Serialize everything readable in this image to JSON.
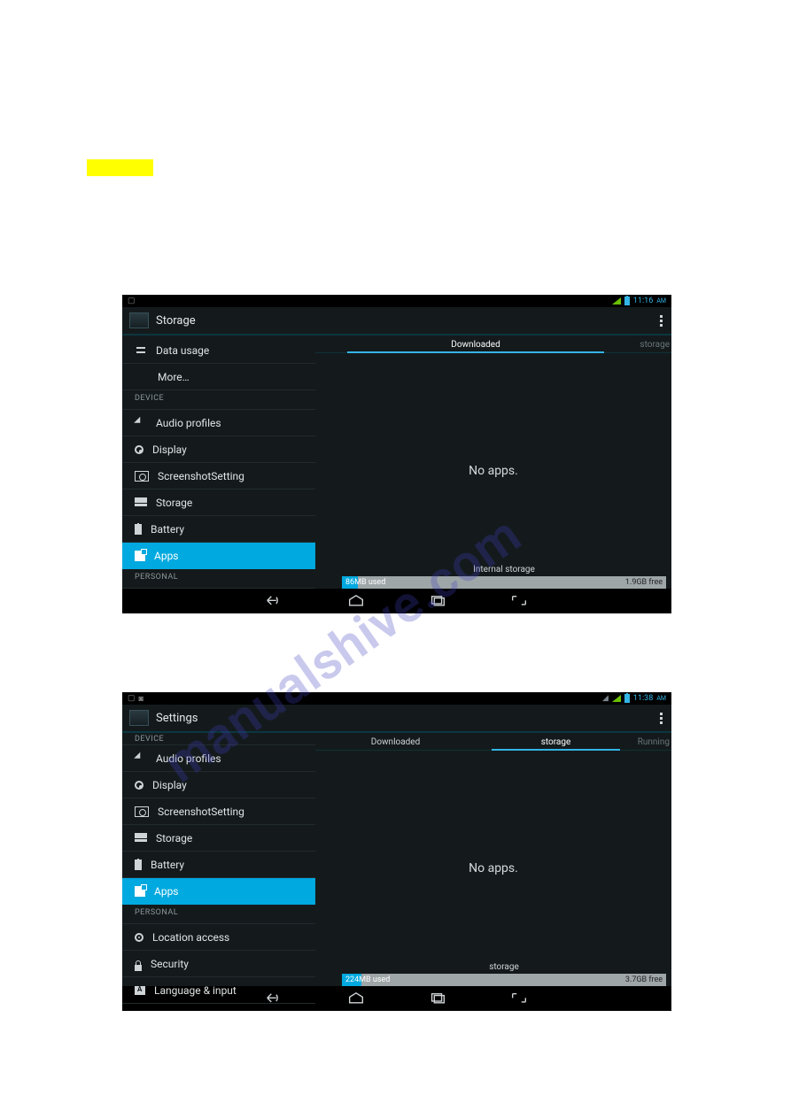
{
  "highlight_mark": true,
  "watermark_text": "manualshive.com",
  "screenshot1": {
    "status_time": "11:16",
    "status_ampm": "AM",
    "title": "Storage",
    "sidebar": {
      "items": [
        {
          "kind": "item",
          "label": "Data usage",
          "icon": "data"
        },
        {
          "kind": "item",
          "label": "More…",
          "icon": "",
          "indent": true
        },
        {
          "kind": "section",
          "label": "DEVICE"
        },
        {
          "kind": "item",
          "label": "Audio profiles",
          "icon": "audio"
        },
        {
          "kind": "item",
          "label": "Display",
          "icon": "display"
        },
        {
          "kind": "item",
          "label": "ScreenshotSetting",
          "icon": "cam"
        },
        {
          "kind": "item",
          "label": "Storage",
          "icon": "storage"
        },
        {
          "kind": "item",
          "label": "Battery",
          "icon": "batt"
        },
        {
          "kind": "item",
          "label": "Apps",
          "icon": "apps",
          "selected": true
        },
        {
          "kind": "section",
          "label": "PERSONAL"
        }
      ]
    },
    "tabs": {
      "items": [
        {
          "label": "Downloaded",
          "active": true
        },
        {
          "label": "storage",
          "cut": true
        }
      ]
    },
    "empty_text": "No apps.",
    "storage": {
      "title": "Internal storage",
      "used_text": "86MB used",
      "free_text": "1.9GB free",
      "used_pct": 5
    }
  },
  "screenshot2": {
    "status_time": "11:38",
    "status_ampm": "AM",
    "title": "Settings",
    "sidebar": {
      "header_section": "DEVICE",
      "items": [
        {
          "kind": "item",
          "label": "Audio profiles",
          "icon": "audio"
        },
        {
          "kind": "item",
          "label": "Display",
          "icon": "display"
        },
        {
          "kind": "item",
          "label": "ScreenshotSetting",
          "icon": "cam"
        },
        {
          "kind": "item",
          "label": "Storage",
          "icon": "storage"
        },
        {
          "kind": "item",
          "label": "Battery",
          "icon": "batt"
        },
        {
          "kind": "item",
          "label": "Apps",
          "icon": "apps",
          "selected": true
        },
        {
          "kind": "section",
          "label": "PERSONAL"
        },
        {
          "kind": "item",
          "label": "Location access",
          "icon": "loc"
        },
        {
          "kind": "item",
          "label": "Security",
          "icon": "lock"
        },
        {
          "kind": "item",
          "label": "Language & input",
          "icon": "lang"
        }
      ]
    },
    "tabs": {
      "items": [
        {
          "label": "Downloaded"
        },
        {
          "label": "storage",
          "active": true
        },
        {
          "label": "Running",
          "cut": true
        }
      ]
    },
    "empty_text": "No apps.",
    "storage": {
      "title": "storage",
      "used_text": "224MB used",
      "free_text": "3.7GB free",
      "used_pct": 6
    }
  }
}
